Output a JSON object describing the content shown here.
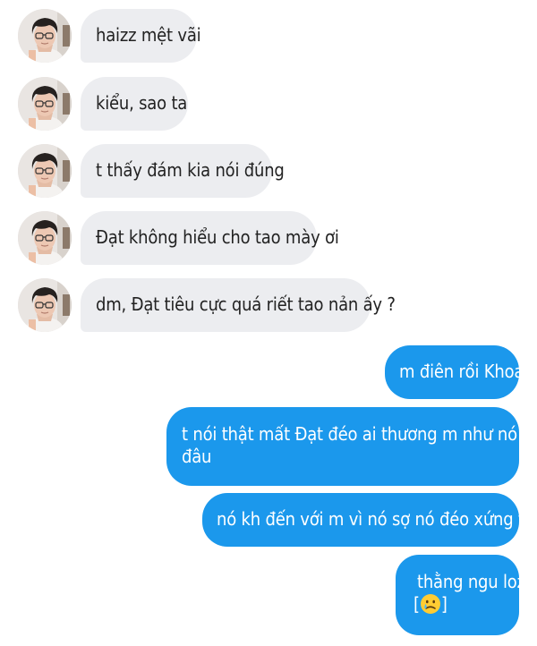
{
  "conversation": {
    "incoming": [
      {
        "text": "haizz mệt vãi"
      },
      {
        "text": "kiểu, sao ta"
      },
      {
        "text": "t thấy đám kia nói đúng"
      },
      {
        "text": "Đạt không hiểu cho tao mày ơi"
      },
      {
        "text": "dm, Đạt tiêu cực quá riết tao nản ấy ?"
      }
    ],
    "outgoing": [
      {
        "text": "m điên rồi Khoa"
      },
      {
        "text_line1": "t nói thật mất Đạt đéo ai thương m như nó",
        "text_line2": "đâu"
      },
      {
        "text": "nó kh đến với m vì nó sợ nó đéo xứng thôi"
      },
      {
        "text_line1": "thằng ngu loz",
        "open_bracket": "[",
        "emoji": "crying-face-emoji",
        "close_bracket": "]"
      }
    ]
  },
  "colors": {
    "incoming_bubble": "#ecedf0",
    "incoming_text": "#222222",
    "outgoing_bubble": "#1b98ec",
    "outgoing_text": "#ffffff"
  }
}
